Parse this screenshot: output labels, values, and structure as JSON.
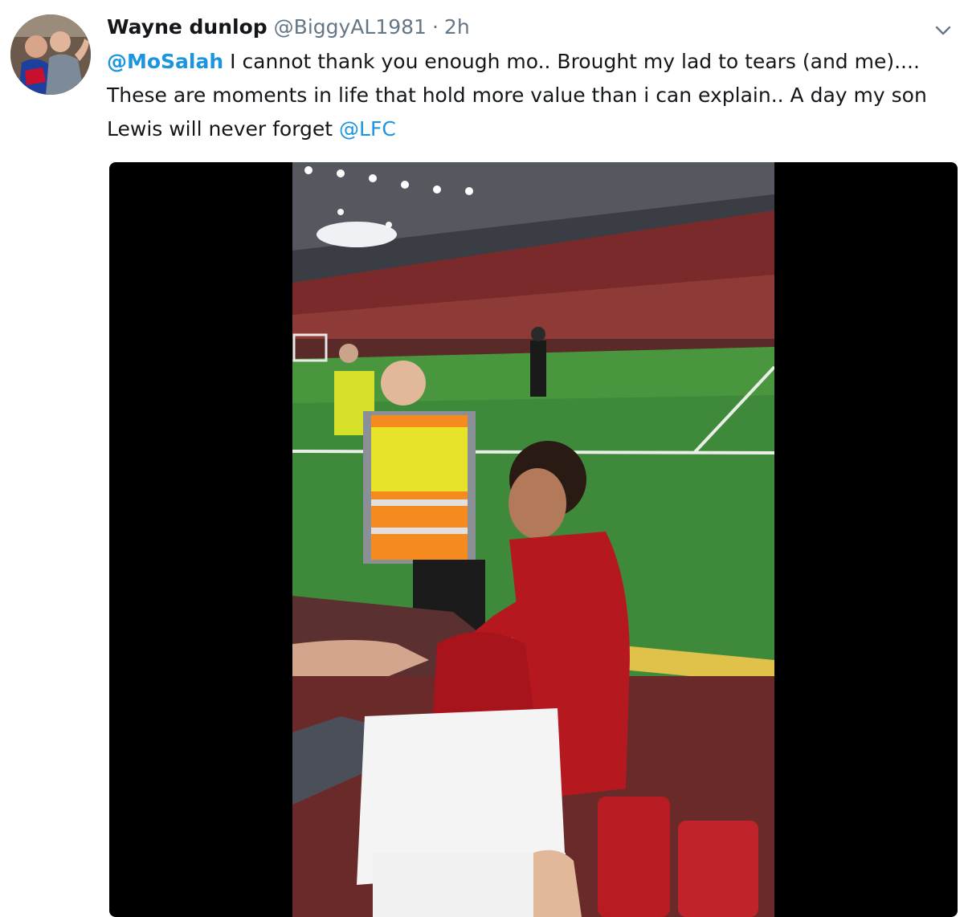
{
  "tweet": {
    "author_name": "Wayne dunlop",
    "author_handle": "@BiggyAL1981",
    "separator": "·",
    "timestamp": "2h",
    "mention_start": "@MoSalah",
    "line1_rest": " I cannot thank you enough mo.. Brought my lad to tears (and me)....",
    "line2": "These are moments in life that hold more value than i can explain.. A day my son",
    "line3_start": "Lewis will never forget ",
    "mention_end": "@LFC"
  },
  "icons": {
    "menu": "chevron-down-icon",
    "avatar": "avatar-photo"
  },
  "colors": {
    "link": "#1b95e0",
    "secondary_text": "#657786",
    "primary_text": "#14171a",
    "media_background": "#000000"
  }
}
